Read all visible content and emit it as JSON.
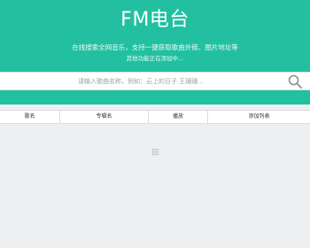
{
  "header": {
    "title": "FM电台",
    "subtitle_line1": "在线搜索全网音乐，支持一键获取歌曲外链、图片地址等",
    "subtitle_line2": "其他功能正在添加中..."
  },
  "search": {
    "placeholder": "请输入歌曲名称，例如：云上的日子 王珊珊...",
    "value": "",
    "button_icon": "search-icon"
  },
  "table": {
    "columns": [
      "歌名",
      "专辑名",
      "播放",
      "添加列表"
    ]
  },
  "colors": {
    "accent": "#22c0a0",
    "background": "#edeff0"
  }
}
